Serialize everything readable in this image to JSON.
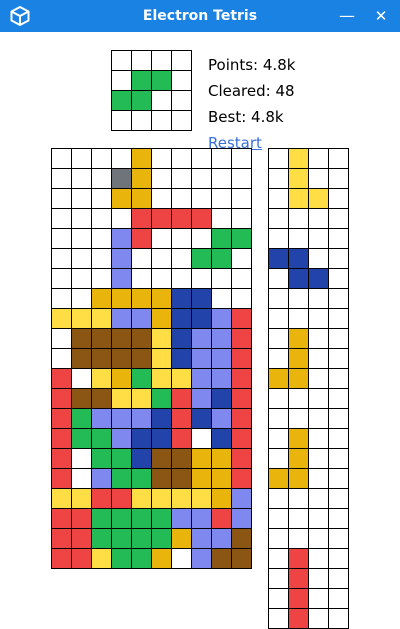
{
  "window": {
    "title": "Electron Tetris",
    "minimize_glyph": "—",
    "close_glyph": "✕",
    "icon": "cube-icon",
    "bar_color": "#1a82e2"
  },
  "stats": {
    "points": "Points: 4.8k",
    "cleared": "Cleared: 48",
    "best": "Best: 4.8k",
    "restart": "Restart"
  },
  "colors": {
    ".": "#ffffff",
    "Y": "#ffdd44",
    "O": "#e9b50c",
    "R": "#ee4444",
    "G": "#22bb55",
    "B": "#2244aa",
    "L": "#7f88ee",
    "N": "#8b5513",
    "X": "#6f737a"
  },
  "preview": {
    "rows": [
      "....",
      ".GG.",
      "GG..",
      "...."
    ]
  },
  "board": {
    "rows": [
      "....O.....",
      "...XO.....",
      "...OO.....",
      "....RRRR..",
      "...LR...GG",
      "...L...GG.",
      "...L......",
      "..OOOOBB..",
      "YYYLLOBBLR",
      ".NNNNYBLLR",
      ".NNNNYBLLR",
      "R.YOGYYLLR",
      "RNNYYGRLBR",
      "RGLLLBRBLR",
      "RGGLBBR.BR",
      "R.GGBNNOOR",
      "R.LGGNNOOR",
      "YYRRYYYYOL",
      "RRGGGGLLRL",
      "RRGGGGOLLN",
      "RRYGGO.LNN"
    ]
  },
  "next_queue": {
    "pieces": [
      [
        "..Y.",
        ".YY.",
        "...."
      ],
      [
        "BB..",
        ".BB.",
        "...."
      ],
      [
        "..O.",
        ".OO.",
        "...."
      ],
      [
        "..O.",
        ".OO.",
        "...."
      ],
      [
        ".R..",
        ".R..",
        ".R.."
      ]
    ],
    "rows": [
      ".Y..",
      ".Y..",
      ".YY.",
      "....",
      "....",
      "BB..",
      ".BB.",
      "....",
      "....",
      ".O..",
      ".O..",
      "OO..",
      "....",
      "....",
      ".O..",
      ".O..",
      "OO..",
      "....",
      "....",
      "....",
      ".R..",
      ".R..",
      ".R..",
      ".R.."
    ]
  }
}
